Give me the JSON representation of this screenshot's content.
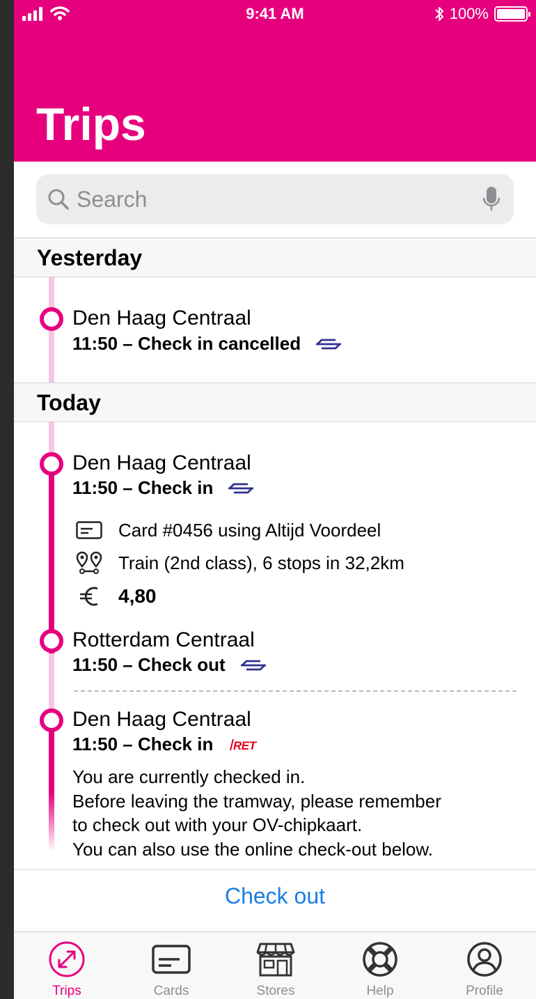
{
  "status_bar": {
    "time": "9:41 AM",
    "battery": "100%"
  },
  "header": {
    "title": "Trips"
  },
  "search": {
    "placeholder": "Search"
  },
  "sections": {
    "yesterday": {
      "label": "Yesterday",
      "stops": [
        {
          "name": "Den Haag Centraal",
          "subtitle": "11:50 – Check in cancelled",
          "operator_icon": "ns-logo-icon"
        }
      ]
    },
    "today": {
      "label": "Today",
      "trip": {
        "check_in": {
          "name": "Den Haag Centraal",
          "subtitle": "11:50 – Check in",
          "operator_icon": "ns-logo-icon"
        },
        "details": {
          "card": "Card #0456 using Altijd Voordeel",
          "route": "Train (2nd class), 6 stops in 32,2km",
          "price": "4,80"
        },
        "check_out": {
          "name": "Rotterdam Centraal",
          "subtitle": "11:50 – Check out",
          "operator_icon": "ns-logo-icon"
        }
      },
      "current": {
        "name": "Den Haag Centraal",
        "subtitle": "11:50 – Check in",
        "operator_icon": "ret-logo-icon",
        "operator_logo_text": "RET",
        "message_lines": [
          "You are currently checked in.",
          "Before leaving the tramway, please remember",
          "to check out with your OV-chipkaart.",
          "You can also use the online check-out below."
        ]
      }
    }
  },
  "checkout_button": "Check out",
  "tabs": [
    {
      "label": "Trips",
      "icon": "trips-icon",
      "active": true
    },
    {
      "label": "Cards",
      "icon": "card-icon",
      "active": false
    },
    {
      "label": "Stores",
      "icon": "store-icon",
      "active": false
    },
    {
      "label": "Help",
      "icon": "lifebuoy-icon",
      "active": false
    },
    {
      "label": "Profile",
      "icon": "profile-icon",
      "active": false
    }
  ],
  "colors": {
    "brand": "#e6007e",
    "brand_light": "#f7c6e1",
    "link": "#1a7ee6",
    "ns_blue": "#2e3192",
    "ret_red": "#e2001a"
  }
}
